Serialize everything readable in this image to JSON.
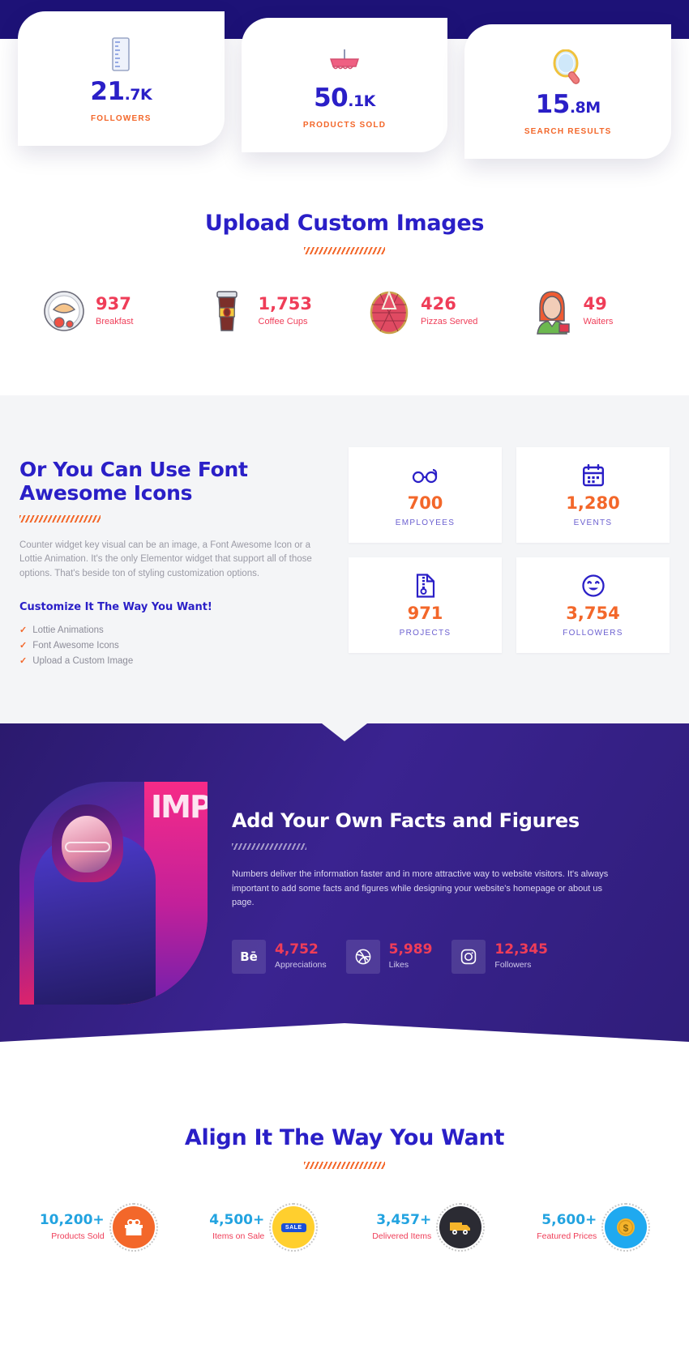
{
  "hero": {
    "cards": [
      {
        "icon": "ruler-icon",
        "number": "21",
        "suffix": ".7K",
        "label": "FOLLOWERS"
      },
      {
        "icon": "boat-icon",
        "number": "50",
        "suffix": ".1K",
        "label": "PRODUCTS SOLD"
      },
      {
        "icon": "magnifier-icon",
        "number": "15",
        "suffix": ".8M",
        "label": "SEARCH RESULTS"
      }
    ]
  },
  "upload": {
    "title": "Upload Custom Images",
    "items": [
      {
        "icon": "breakfast-plate-icon",
        "number": "937",
        "label": "Breakfast"
      },
      {
        "icon": "coffee-cup-icon",
        "number": "1,753",
        "label": "Coffee Cups"
      },
      {
        "icon": "pizza-icon",
        "number": "426",
        "label": "Pizzas Served"
      },
      {
        "icon": "waitress-icon",
        "number": "49",
        "label": "Waiters"
      }
    ]
  },
  "fontawesome": {
    "heading": "Or You Can Use Font Awesome Icons",
    "paragraph": "Counter widget key visual can be an image, a Font Awesome Icon or a Lottie Animation. It's the only Elementor widget that support all of those options. That's beside ton of styling customization options.",
    "subheading": "Customize It The Way You Want!",
    "list": [
      "Lottie Animations",
      "Font Awesome Icons",
      "Upload a Custom Image"
    ],
    "cards": [
      {
        "icon": "glasses-icon",
        "number": "700",
        "label": "EMPLOYEES"
      },
      {
        "icon": "calendar-icon",
        "number": "1,280",
        "label": "EVENTS"
      },
      {
        "icon": "file-zip-icon",
        "number": "971",
        "label": "PROJECTS"
      },
      {
        "icon": "smiley-icon",
        "number": "3,754",
        "label": "FOLLOWERS"
      }
    ]
  },
  "facts": {
    "heading": "Add Your Own Facts and Figures",
    "paragraph": "Numbers deliver the information faster and in more attractive way to website visitors. It's always important to add some facts and figures while designing your website's homepage or about us page.",
    "photo_text": "IMPA",
    "socials": [
      {
        "icon": "behance-icon",
        "glyph": "Bē",
        "number": "4,752",
        "label": "Appreciations"
      },
      {
        "icon": "dribbble-icon",
        "glyph": "",
        "number": "5,989",
        "label": "Likes"
      },
      {
        "icon": "instagram-icon",
        "glyph": "",
        "number": "12,345",
        "label": "Followers"
      }
    ]
  },
  "align": {
    "title": "Align It The Way You Want",
    "items": [
      {
        "number": "10,200+",
        "label": "Products Sold",
        "icon": "gift-icon",
        "circle": "ac-orange"
      },
      {
        "number": "4,500+",
        "label": "Items on Sale",
        "icon": "sale-icon",
        "circle": "ac-yellow"
      },
      {
        "number": "3,457+",
        "label": "Delivered Items",
        "icon": "truck-icon",
        "circle": "ac-dark"
      },
      {
        "number": "5,600+",
        "label": "Featured Prices",
        "icon": "coin-icon",
        "circle": "ac-blue"
      }
    ]
  },
  "colors": {
    "brand_blue": "#2a1fc7",
    "orange": "#f3672a",
    "red": "#ef3d58",
    "purple_bg": "#2f1d79",
    "light_gray": "#f4f5f7",
    "cyan": "#22a3e0"
  }
}
